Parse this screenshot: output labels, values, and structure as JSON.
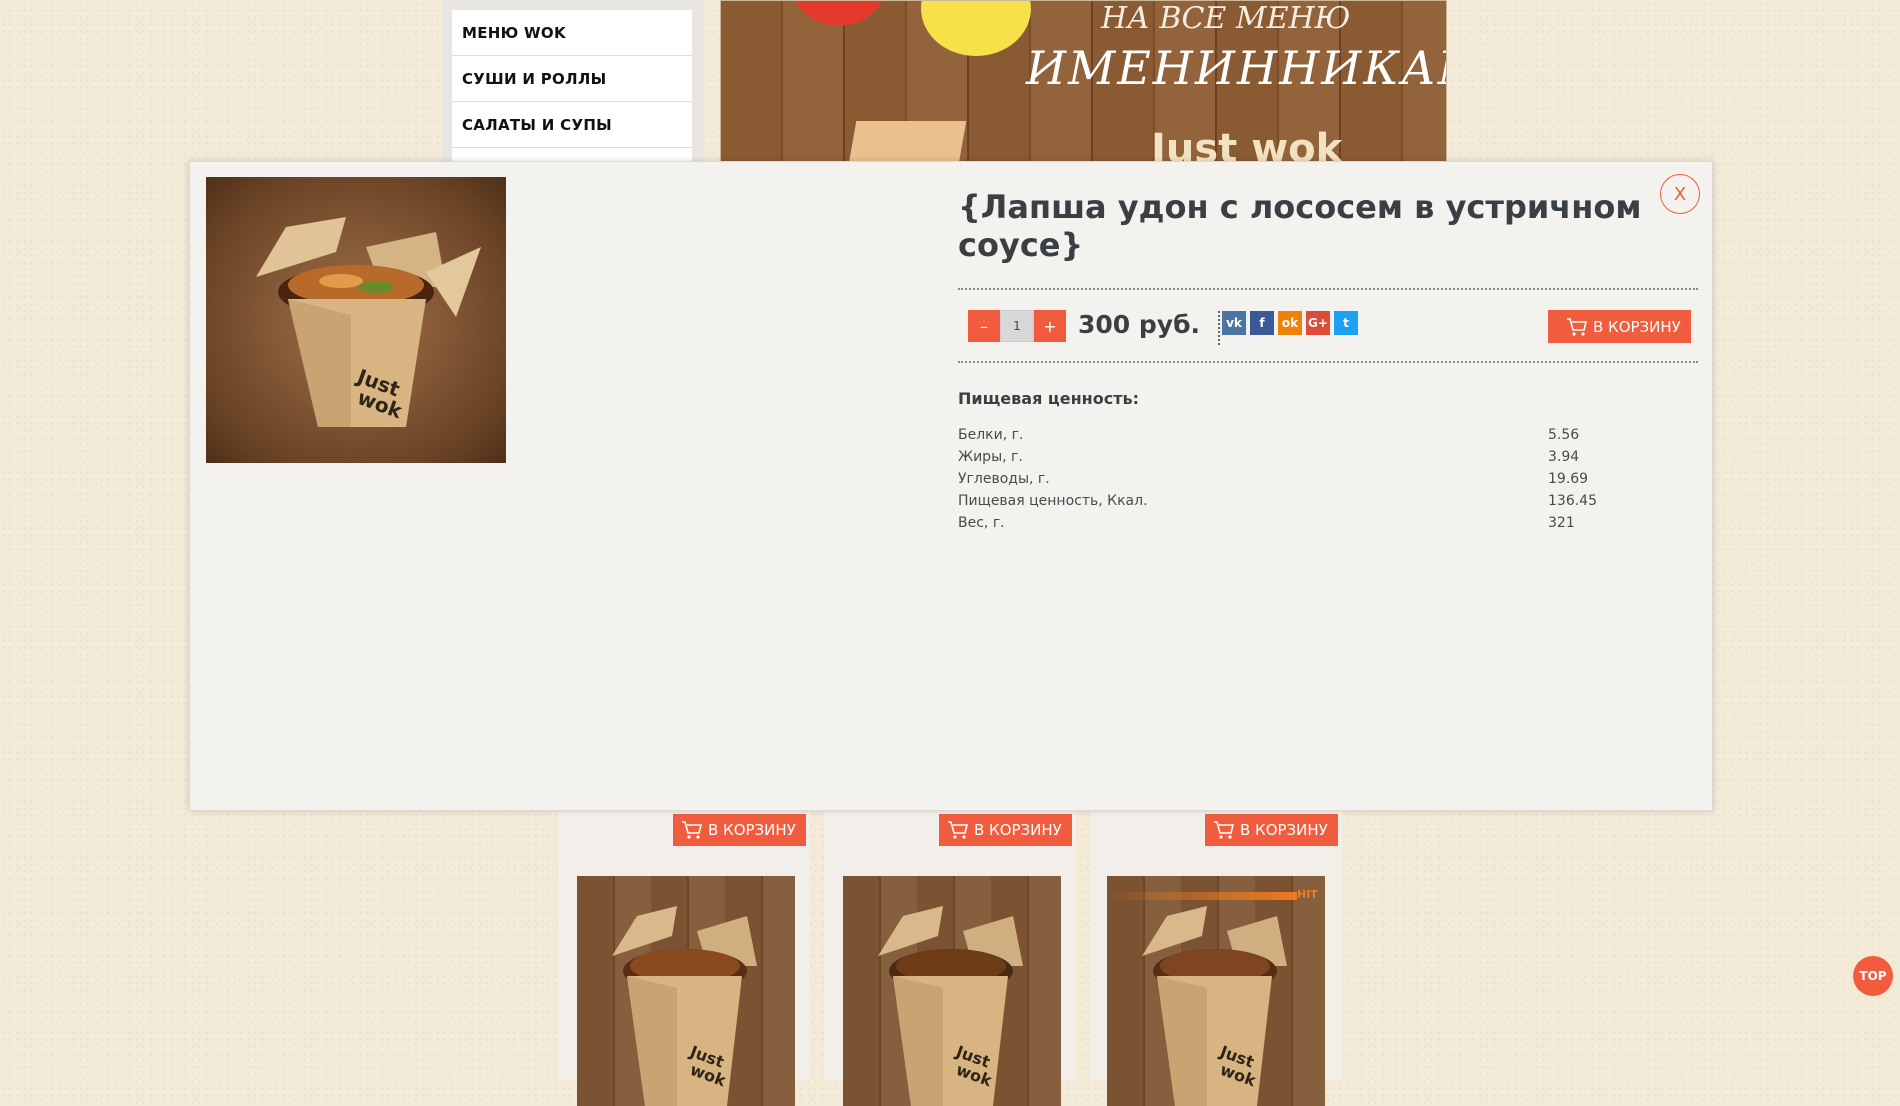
{
  "sidebar": {
    "items": [
      {
        "label": "МЕНЮ WOK"
      },
      {
        "label": "СУШИ И РОЛЛЫ"
      },
      {
        "label": "САЛАТЫ И СУПЫ"
      }
    ]
  },
  "banner": {
    "line1": "НА ВСЕ МЕНЮ",
    "line2": "ИМЕНИННИКАМ!*",
    "brand": "Just wok"
  },
  "modal": {
    "title": "{Лапша удон с лососем в устричном соусе}",
    "close_label": "X",
    "quantity": "1",
    "minus_label": "–",
    "plus_label": "+",
    "price": "300 руб.",
    "cart_label": "В КОРЗИНУ",
    "share": [
      {
        "label": "vk",
        "icon": "vk-icon",
        "color": "#4c75a3"
      },
      {
        "label": "f",
        "icon": "facebook-icon",
        "color": "#3b5998"
      },
      {
        "label": "ok",
        "icon": "odnoklassniki-icon",
        "color": "#ee8208"
      },
      {
        "label": "G+",
        "icon": "google-plus-icon",
        "color": "#dd4b39"
      },
      {
        "label": "t",
        "icon": "twitter-icon",
        "color": "#1da1f2"
      }
    ],
    "nutrition_title": "Пищевая ценность:",
    "nutrition": [
      {
        "label": "Белки, г.",
        "value": "5.56"
      },
      {
        "label": "Жиры, г.",
        "value": "3.94"
      },
      {
        "label": "Углеводы, г.",
        "value": "19.69"
      },
      {
        "label": "Пищевая ценность, Ккал.",
        "value": "136.45"
      },
      {
        "label": "Вес, г.",
        "value": "321"
      }
    ]
  },
  "products": [
    {
      "cart_label": "В КОРЗИНУ"
    },
    {
      "cart_label": "В КОРЗИНУ"
    },
    {
      "cart_label": "В КОРЗИНУ",
      "badge": "HIT"
    }
  ],
  "top_button": {
    "label": "TOP"
  },
  "colors": {
    "accent": "#f15b3e",
    "text": "#3a3f44"
  }
}
